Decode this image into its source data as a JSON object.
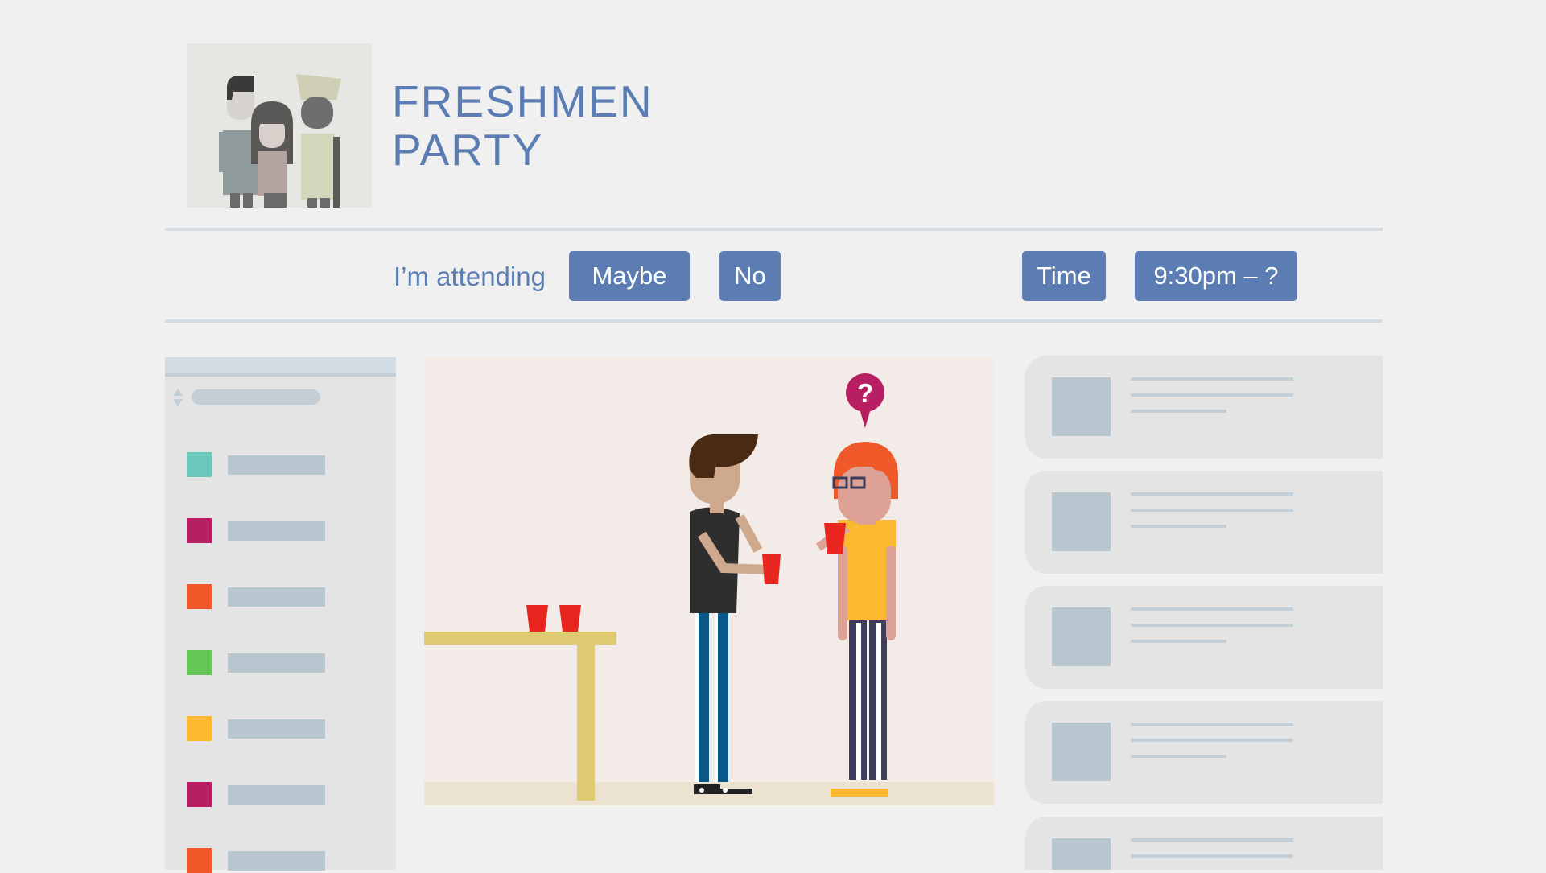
{
  "event": {
    "title_line1": "FRESHMEN",
    "title_line2": "PARTY"
  },
  "rsvp": {
    "label": "I’m attending",
    "options": [
      "Maybe",
      "No"
    ]
  },
  "time": {
    "label": "Time",
    "value": "9:30pm – ?"
  },
  "sidebar": {
    "item_colors": [
      "#6cc8ba",
      "#b81f63",
      "#f05a2b",
      "#64c656",
      "#fbb92f",
      "#b81f63",
      "#f05a2b"
    ]
  },
  "scene": {
    "speech_bubble_text": "?"
  },
  "colors": {
    "accent": "#5b7db3",
    "background": "#f0f0f0",
    "panel": "#e4e4e4",
    "placeholder": "#b8c6cf"
  }
}
